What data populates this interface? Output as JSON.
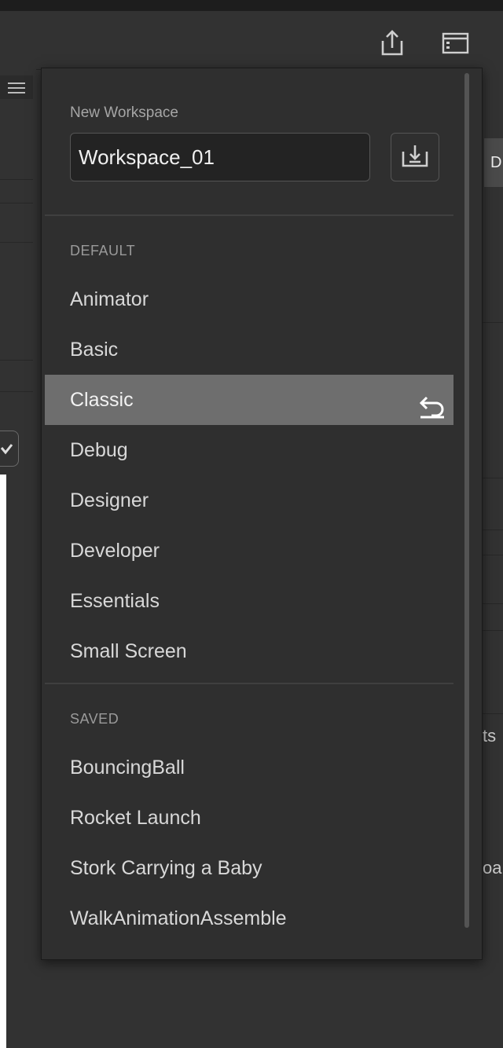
{
  "colors": {
    "popup_bg": "#2f2f2f",
    "selected_bg": "#6e6e6e",
    "text": "#d8d8d8",
    "muted": "#9a9a9a"
  },
  "header_icons": [
    "share-icon",
    "panel-layout-icon"
  ],
  "workspace_menu": {
    "new_workspace_label": "New Workspace",
    "new_workspace_value": "Workspace_01",
    "save_icon": "save-workspace-icon",
    "default_section_label": "DEFAULT",
    "default_items": [
      {
        "label": "Animator"
      },
      {
        "label": "Basic"
      },
      {
        "label": "Classic",
        "selected": true,
        "icon": "reset-icon"
      },
      {
        "label": "Debug"
      },
      {
        "label": "Designer"
      },
      {
        "label": "Developer"
      },
      {
        "label": "Essentials"
      },
      {
        "label": "Small Screen"
      }
    ],
    "saved_section_label": "SAVED",
    "saved_items": [
      {
        "label": "BouncingBall"
      },
      {
        "label": "Rocket Launch"
      },
      {
        "label": "Stork Carrying a Baby"
      },
      {
        "label": "WalkAnimationAssemble"
      }
    ]
  },
  "right_edge": {
    "tab_text": "D",
    "cut_text_1": "ts",
    "cut_text_2": "oa"
  }
}
